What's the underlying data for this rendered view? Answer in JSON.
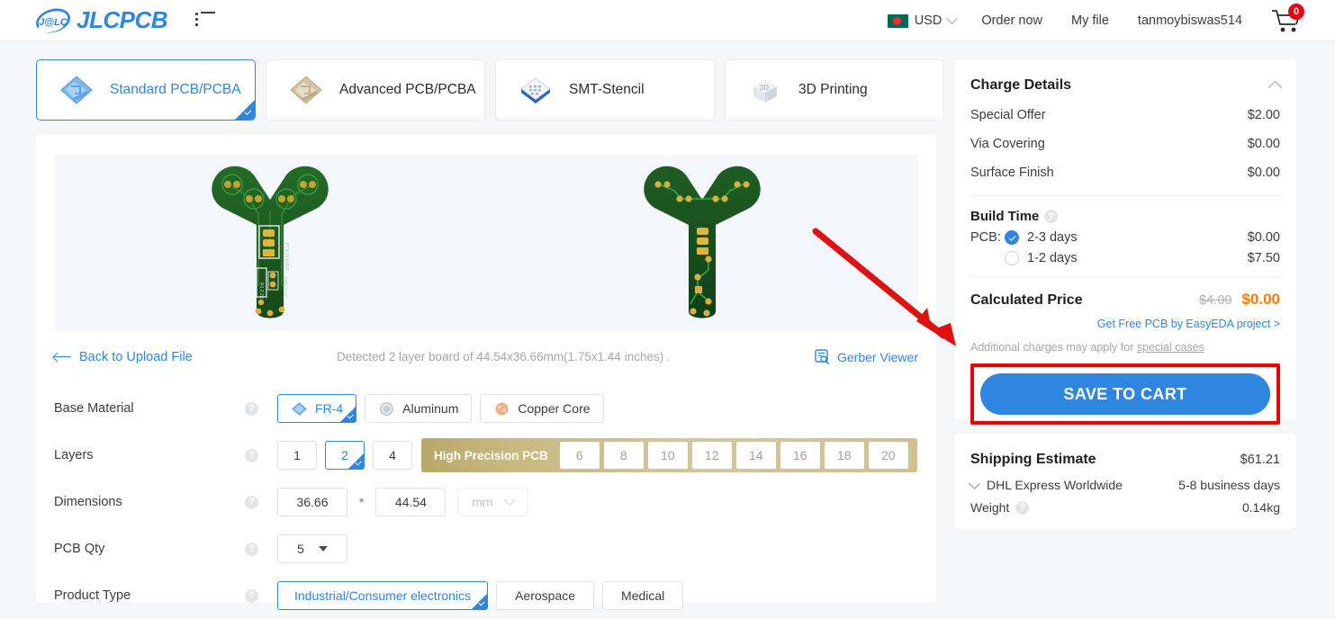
{
  "header": {
    "logo_text": "JLCPCB",
    "logo_mark": "J@LC",
    "menu_icon": "hamburger-icon",
    "currency": "USD",
    "links": [
      {
        "label": "Order now"
      },
      {
        "label": "My file"
      },
      {
        "label": "tanmoybiswas514"
      }
    ],
    "cart_count": "0"
  },
  "tabs": [
    {
      "label": "Standard PCB/PCBA",
      "active": true
    },
    {
      "label": "Advanced PCB/PCBA",
      "active": false
    },
    {
      "label": "SMT-Stencil",
      "active": false
    },
    {
      "label": "3D Printing",
      "active": false
    }
  ],
  "preview": {
    "back_link": "Back to Upload File",
    "detected": "Detected 2 layer board of 44.54x36.66mm(1.75x1.44 inches) .",
    "gerber_viewer": "Gerber Viewer"
  },
  "form": {
    "base_material": {
      "label": "Base Material",
      "options": [
        {
          "label": "FR-4",
          "selected": true
        },
        {
          "label": "Aluminum",
          "selected": false
        },
        {
          "label": "Copper Core",
          "selected": false
        }
      ]
    },
    "layers": {
      "label": "Layers",
      "options": [
        {
          "label": "1",
          "selected": false
        },
        {
          "label": "2",
          "selected": true
        },
        {
          "label": "4",
          "selected": false
        }
      ],
      "high_precision_label": "High Precision PCB",
      "high_precision_options": [
        "6",
        "8",
        "10",
        "12",
        "14",
        "16",
        "18",
        "20"
      ]
    },
    "dimensions": {
      "label": "Dimensions",
      "width": "36.66",
      "separator": "*",
      "height": "44.54",
      "unit": "mm"
    },
    "pcb_qty": {
      "label": "PCB Qty",
      "value": "5"
    },
    "product_type": {
      "label": "Product Type",
      "options": [
        {
          "label": "Industrial/Consumer electronics",
          "selected": true
        },
        {
          "label": "Aerospace",
          "selected": false
        },
        {
          "label": "Medical",
          "selected": false
        }
      ]
    }
  },
  "charge_details": {
    "title": "Charge Details",
    "lines": [
      {
        "label": "Special Offer",
        "value": "$2.00"
      },
      {
        "label": "Via Covering",
        "value": "$0.00"
      },
      {
        "label": "Surface Finish",
        "value": "$0.00"
      }
    ],
    "build_time": {
      "title": "Build Time",
      "pcb_label": "PCB:",
      "options": [
        {
          "label": "2-3 days",
          "price": "$0.00",
          "selected": true
        },
        {
          "label": "1-2 days",
          "price": "$7.50",
          "selected": false
        }
      ]
    },
    "calculated_price": {
      "label": "Calculated Price",
      "old_value": "$4.00",
      "new_value": "$0.00"
    },
    "easyeda_link": "Get Free PCB by EasyEDA project >",
    "additional_note_prefix": "Additional charges may apply for ",
    "additional_note_link": "special cases",
    "save_to_cart": "SAVE TO CART"
  },
  "shipping": {
    "title": "Shipping Estimate",
    "price": "$61.21",
    "carrier": "DHL Express Worldwide",
    "eta": "5-8 business days",
    "weight_label": "Weight",
    "weight_value": "0.14kg"
  },
  "colors": {
    "accent_blue": "#2f86e0",
    "price_orange": "#ff7a00",
    "highlight_red": "#ee0000",
    "gold": "#c8b982",
    "pcb_green": "#1d5c1f"
  }
}
